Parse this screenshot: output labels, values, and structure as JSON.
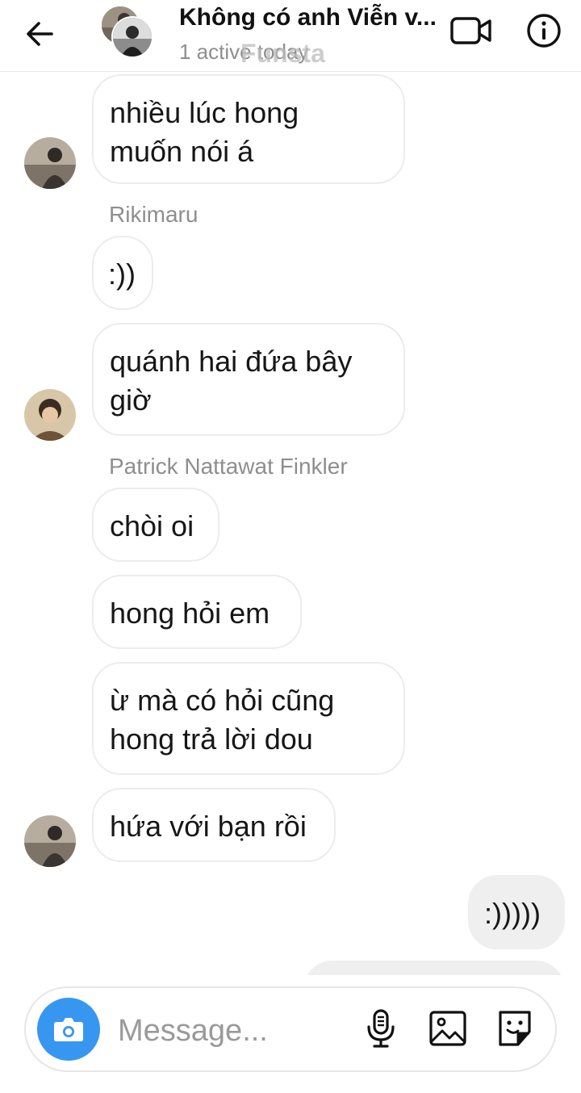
{
  "header": {
    "title": "Không có anh Viễn v...",
    "status": "1 active today",
    "watermark": "Funsta"
  },
  "messages": [
    {
      "direction": "in",
      "text": "nhiều lúc hong\nmuốn nói á"
    },
    {
      "direction": "in",
      "sender": "Rikimaru",
      "text": ":))"
    },
    {
      "direction": "in",
      "text": "quánh hai đứa bây\ngiờ"
    },
    {
      "direction": "in",
      "sender": "Patrick Nattawat Finkler",
      "text": "chòi oi"
    },
    {
      "direction": "in",
      "text": "hong hỏi em"
    },
    {
      "direction": "in",
      "text": "ừ mà có hỏi cũng\nhong trả lời dou"
    },
    {
      "direction": "in",
      "text": "hứa với bạn rồi"
    },
    {
      "direction": "out",
      "text": ":)))))"
    }
  ],
  "composer": {
    "placeholder": "Message...",
    "accent_color": "#3797f0"
  },
  "icons": [
    "back-arrow-icon",
    "video-call-icon",
    "info-icon",
    "camera-icon",
    "microphone-icon",
    "gallery-icon",
    "sticker-icon"
  ]
}
